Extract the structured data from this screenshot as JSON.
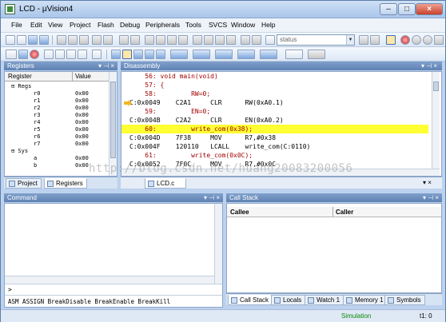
{
  "window": {
    "title": "LCD - µVision4",
    "min": "–",
    "max": "□",
    "close": "×"
  },
  "menu": [
    "File",
    "Edit",
    "View",
    "Project",
    "Flash",
    "Debug",
    "Peripherals",
    "Tools",
    "SVCS",
    "Window",
    "Help"
  ],
  "toolbar": {
    "combo_value": "status"
  },
  "registers": {
    "title": "Registers",
    "col_register": "Register",
    "col_value": "Value",
    "rows": [
      {
        "name": "Regs",
        "value": "",
        "indent": 0
      },
      {
        "name": "r0",
        "value": "0x00",
        "indent": 1
      },
      {
        "name": "r1",
        "value": "0x00",
        "indent": 1
      },
      {
        "name": "r2",
        "value": "0x00",
        "indent": 1
      },
      {
        "name": "r3",
        "value": "0x00",
        "indent": 1
      },
      {
        "name": "r4",
        "value": "0x00",
        "indent": 1
      },
      {
        "name": "r5",
        "value": "0x00",
        "indent": 1
      },
      {
        "name": "r6",
        "value": "0x00",
        "indent": 1
      },
      {
        "name": "r7",
        "value": "0x00",
        "indent": 1
      },
      {
        "name": "Sys",
        "value": "",
        "indent": 0
      },
      {
        "name": "a",
        "value": "0x00",
        "indent": 1
      },
      {
        "name": "b",
        "value": "0x00",
        "indent": 1
      }
    ],
    "tabs": [
      "Project",
      "Registers"
    ]
  },
  "disassembly": {
    "title": "Disassembly",
    "lines": [
      {
        "text": "    56: void main(void)",
        "kind": "src"
      },
      {
        "text": "    57: {",
        "kind": "src"
      },
      {
        "text": "    58:         RW=0;",
        "kind": "src"
      },
      {
        "text": "C:0x0049    C2A1     CLR      RW(0xA0.1)",
        "kind": "asm"
      },
      {
        "text": "    59:         EN=0;",
        "kind": "src"
      },
      {
        "text": "C:0x004B    C2A2     CLR      EN(0xA0.2)",
        "kind": "asm"
      },
      {
        "text": "    60:         write_com(0x38);",
        "kind": "hl"
      },
      {
        "text": "C:0x004D    7F38     MOV      R7,#0x38",
        "kind": "asm"
      },
      {
        "text": "C:0x004F    120110   LCALL    write_com(C:0110)",
        "kind": "asm"
      },
      {
        "text": "    61:         write_com(0x0C);",
        "kind": "src"
      },
      {
        "text": "C:0x0052    7F0C     MOV      R7,#0x0C",
        "kind": "asm"
      }
    ],
    "file_tab": "LCD.c",
    "watermark": "http://blog.csdn.net/huang20083200056"
  },
  "command": {
    "title": "Command",
    "prompt": ">",
    "hint": "ASM ASSIGN BreakDisable BreakEnable BreakKill"
  },
  "callstack": {
    "title": "Call Stack",
    "col_callee": "Callee",
    "col_caller": "Caller",
    "tabs": [
      "Call Stack",
      "Locals",
      "Watch 1",
      "Memory 1",
      "Symbols"
    ]
  },
  "status": {
    "mode": "Simulation",
    "time": "t1: 0"
  },
  "colors": {
    "highlight": "#ffff33",
    "source_text": "#a00000",
    "panel_header": "#6f90c0",
    "simulation_text": "#0a8a0a"
  }
}
